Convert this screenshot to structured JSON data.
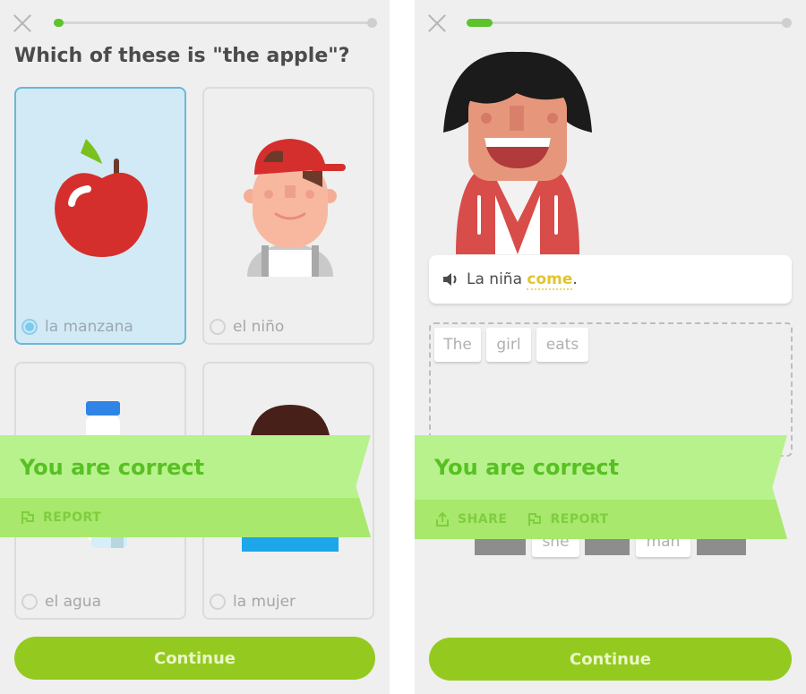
{
  "left": {
    "progress": 0.03,
    "question": "Which of these is \"the apple\"?",
    "options": [
      {
        "label": "la manzana",
        "image": "apple",
        "selected": true
      },
      {
        "label": "el niño",
        "image": "boy",
        "selected": false
      },
      {
        "label": "el agua",
        "image": "water-bottle",
        "selected": false
      },
      {
        "label": "la mujer",
        "image": "woman",
        "selected": false
      }
    ],
    "banner": {
      "message": "You are correct",
      "report_label": "REPORT"
    },
    "continue_label": "Continue"
  },
  "right": {
    "progress": 0.08,
    "sentence": {
      "prefix": "La niña ",
      "hint_word": "come",
      "suffix": "."
    },
    "answer_tiles": [
      "The",
      "girl",
      "eats"
    ],
    "bank_tiles": [
      "she",
      "man"
    ],
    "banner": {
      "message": "You are correct",
      "share_label": "SHARE",
      "report_label": "REPORT"
    },
    "continue_label": "Continue"
  },
  "colors": {
    "accent_green": "#94ca1f",
    "banner_bg": "#b8f28c",
    "banner_text": "#58c024",
    "selected_blue": "#d2eaf6"
  }
}
